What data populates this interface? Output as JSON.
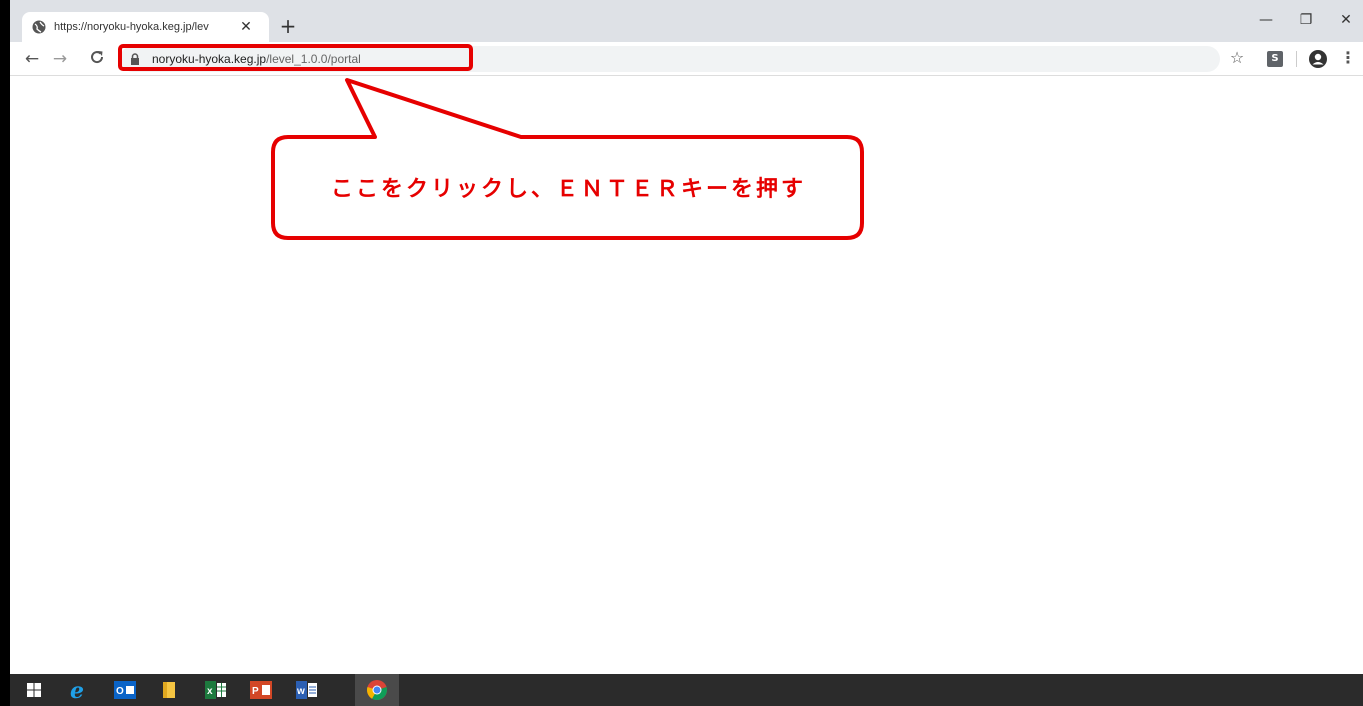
{
  "browser": {
    "tab_title": "https://noryoku-hyoka.keg.jp/lev",
    "tab_close": "✕",
    "new_tab": "+",
    "window_controls": {
      "minimize": "—",
      "maximize": "❐",
      "close": "✕"
    },
    "nav": {
      "back": "←",
      "forward": "→",
      "reload": "C"
    },
    "url_host": "noryoku-hyoka.keg.jp",
    "url_path": "/level_1.0.0/portal",
    "star": "☆",
    "extension_label": "S",
    "menu": "⋮"
  },
  "callout": {
    "text": "ここをクリックし、ＥＮＴＥＲキーを押す",
    "color": "#e60000"
  },
  "taskbar": {
    "apps": [
      {
        "name": "windows-start",
        "icon": "windows-logo-icon"
      },
      {
        "name": "internet-explorer",
        "icon": "ie-icon"
      },
      {
        "name": "outlook",
        "icon": "outlook-icon"
      },
      {
        "name": "file-explorer",
        "icon": "folder-icon"
      },
      {
        "name": "excel",
        "icon": "excel-icon"
      },
      {
        "name": "powerpoint",
        "icon": "powerpoint-icon"
      },
      {
        "name": "word",
        "icon": "word-icon"
      },
      {
        "name": "chrome",
        "icon": "chrome-icon"
      }
    ]
  }
}
